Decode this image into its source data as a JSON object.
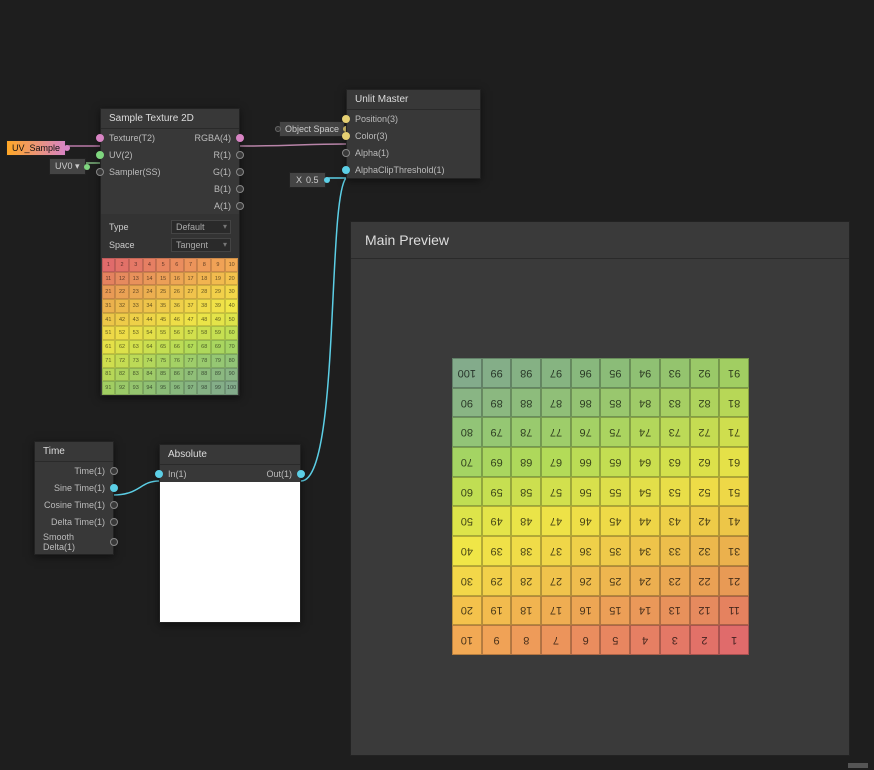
{
  "chips": {
    "uv_sample": "UV_Sample",
    "uv0": "UV0 ▾",
    "object_space": "Object Space",
    "x_value": "X",
    "x_num": "0.5"
  },
  "sample_texture": {
    "title": "Sample Texture 2D",
    "in_ports": [
      "Texture(T2)",
      "UV(2)",
      "Sampler(SS)"
    ],
    "out_ports": [
      "RGBA(4)",
      "R(1)",
      "G(1)",
      "B(1)",
      "A(1)"
    ],
    "params": {
      "type_label": "Type",
      "type_value": "Default",
      "space_label": "Space",
      "space_value": "Tangent"
    }
  },
  "unlit_master": {
    "title": "Unlit Master",
    "in_ports": [
      "Position(3)",
      "Color(3)",
      "Alpha(1)",
      "AlphaClipThreshold(1)"
    ]
  },
  "time_node": {
    "title": "Time",
    "out_ports": [
      "Time(1)",
      "Sine Time(1)",
      "Cosine Time(1)",
      "Delta Time(1)",
      "Smooth Delta(1)"
    ]
  },
  "absolute_node": {
    "title": "Absolute",
    "in_port": "In(1)",
    "out_port": "Out(1)"
  },
  "main_preview": {
    "title": "Main Preview"
  },
  "grid_numbers": [
    1,
    2,
    3,
    4,
    5,
    6,
    7,
    8,
    9,
    10,
    11,
    12,
    13,
    14,
    15,
    16,
    17,
    18,
    19,
    20,
    21,
    22,
    23,
    24,
    25,
    26,
    27,
    28,
    29,
    30,
    31,
    32,
    33,
    34,
    35,
    36,
    37,
    38,
    39,
    40,
    41,
    42,
    43,
    44,
    45,
    46,
    47,
    48,
    49,
    50,
    51,
    52,
    53,
    54,
    55,
    56,
    57,
    58,
    59,
    60,
    61,
    62,
    63,
    64,
    65,
    66,
    67,
    68,
    69,
    70,
    71,
    72,
    73,
    74,
    75,
    76,
    77,
    78,
    79,
    80,
    81,
    82,
    83,
    84,
    85,
    86,
    87,
    88,
    89,
    90,
    91,
    92,
    93,
    94,
    95,
    96,
    97,
    98,
    99,
    100
  ],
  "grid_colors": [
    "#e06b6b",
    "#e27168",
    "#e47866",
    "#e67f63",
    "#e88660",
    "#ea8d5e",
    "#ec945b",
    "#ee9b59",
    "#f0a256",
    "#f2a954",
    "#e5825f",
    "#e68a5e",
    "#e8915b",
    "#ea9859",
    "#ec9f57",
    "#eda654",
    "#efad52",
    "#f1b450",
    "#f2bb4e",
    "#f4c24c",
    "#e89a55",
    "#eaa154",
    "#eba852",
    "#ecaf50",
    "#eeb64f",
    "#efbd4e",
    "#f0c34c",
    "#f1ca4b",
    "#f2d04a",
    "#f3d749",
    "#ebb14d",
    "#ecb84c",
    "#edbe4b",
    "#eec44a",
    "#efca4a",
    "#efd049",
    "#f0d648",
    "#f0dc48",
    "#f0e148",
    "#f0e647",
    "#edc648",
    "#eecb48",
    "#eed048",
    "#eed547",
    "#eeda47",
    "#eede47",
    "#eee247",
    "#eae448",
    "#e4e449",
    "#dde44a",
    "#eed847",
    "#eedc47",
    "#e9de48",
    "#e3df49",
    "#dedf4a",
    "#d8e04c",
    "#d2e04d",
    "#ccdf4f",
    "#c6df51",
    "#c0de53",
    "#e5e148",
    "#dce14a",
    "#d3e04c",
    "#cbdf4f",
    "#c3de52",
    "#bbdc55",
    "#b3db58",
    "#aed85b",
    "#a9d65f",
    "#a4d463",
    "#cfde4e",
    "#c5dc52",
    "#bcda57",
    "#b3d75b",
    "#abd460",
    "#a4d165",
    "#9ecd6a",
    "#99ca6e",
    "#95c773",
    "#92c477",
    "#b7d757",
    "#aed35d",
    "#a6cf63",
    "#9fcb68",
    "#99c76e",
    "#94c373",
    "#90bf78",
    "#8dbc7c",
    "#8bb880",
    "#89b584",
    "#a1ce62",
    "#9ac968",
    "#94c46e",
    "#8fc073",
    "#8bbc78",
    "#88b87d",
    "#86b481",
    "#85b184",
    "#84ae88",
    "#83ab8b"
  ]
}
